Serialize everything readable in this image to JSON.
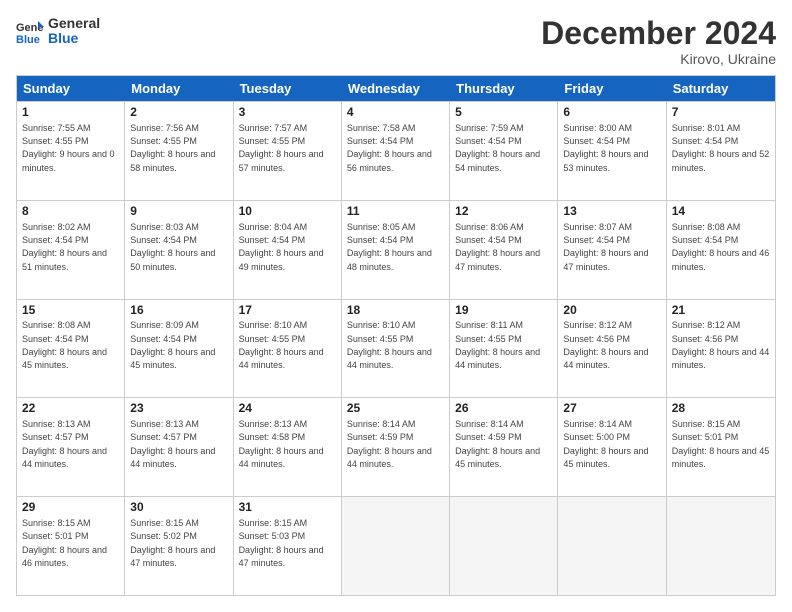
{
  "logo": {
    "line1": "General",
    "line2": "Blue"
  },
  "title": "December 2024",
  "location": "Kirovo, Ukraine",
  "header": {
    "days": [
      "Sunday",
      "Monday",
      "Tuesday",
      "Wednesday",
      "Thursday",
      "Friday",
      "Saturday"
    ]
  },
  "weeks": [
    [
      {
        "day": "1",
        "sunrise": "7:55 AM",
        "sunset": "4:55 PM",
        "daylight": "9 hours and 0 minutes."
      },
      {
        "day": "2",
        "sunrise": "7:56 AM",
        "sunset": "4:55 PM",
        "daylight": "8 hours and 58 minutes."
      },
      {
        "day": "3",
        "sunrise": "7:57 AM",
        "sunset": "4:55 PM",
        "daylight": "8 hours and 57 minutes."
      },
      {
        "day": "4",
        "sunrise": "7:58 AM",
        "sunset": "4:54 PM",
        "daylight": "8 hours and 56 minutes."
      },
      {
        "day": "5",
        "sunrise": "7:59 AM",
        "sunset": "4:54 PM",
        "daylight": "8 hours and 54 minutes."
      },
      {
        "day": "6",
        "sunrise": "8:00 AM",
        "sunset": "4:54 PM",
        "daylight": "8 hours and 53 minutes."
      },
      {
        "day": "7",
        "sunrise": "8:01 AM",
        "sunset": "4:54 PM",
        "daylight": "8 hours and 52 minutes."
      }
    ],
    [
      {
        "day": "8",
        "sunrise": "8:02 AM",
        "sunset": "4:54 PM",
        "daylight": "8 hours and 51 minutes."
      },
      {
        "day": "9",
        "sunrise": "8:03 AM",
        "sunset": "4:54 PM",
        "daylight": "8 hours and 50 minutes."
      },
      {
        "day": "10",
        "sunrise": "8:04 AM",
        "sunset": "4:54 PM",
        "daylight": "8 hours and 49 minutes."
      },
      {
        "day": "11",
        "sunrise": "8:05 AM",
        "sunset": "4:54 PM",
        "daylight": "8 hours and 48 minutes."
      },
      {
        "day": "12",
        "sunrise": "8:06 AM",
        "sunset": "4:54 PM",
        "daylight": "8 hours and 47 minutes."
      },
      {
        "day": "13",
        "sunrise": "8:07 AM",
        "sunset": "4:54 PM",
        "daylight": "8 hours and 47 minutes."
      },
      {
        "day": "14",
        "sunrise": "8:08 AM",
        "sunset": "4:54 PM",
        "daylight": "8 hours and 46 minutes."
      }
    ],
    [
      {
        "day": "15",
        "sunrise": "8:08 AM",
        "sunset": "4:54 PM",
        "daylight": "8 hours and 45 minutes."
      },
      {
        "day": "16",
        "sunrise": "8:09 AM",
        "sunset": "4:54 PM",
        "daylight": "8 hours and 45 minutes."
      },
      {
        "day": "17",
        "sunrise": "8:10 AM",
        "sunset": "4:55 PM",
        "daylight": "8 hours and 44 minutes."
      },
      {
        "day": "18",
        "sunrise": "8:10 AM",
        "sunset": "4:55 PM",
        "daylight": "8 hours and 44 minutes."
      },
      {
        "day": "19",
        "sunrise": "8:11 AM",
        "sunset": "4:55 PM",
        "daylight": "8 hours and 44 minutes."
      },
      {
        "day": "20",
        "sunrise": "8:12 AM",
        "sunset": "4:56 PM",
        "daylight": "8 hours and 44 minutes."
      },
      {
        "day": "21",
        "sunrise": "8:12 AM",
        "sunset": "4:56 PM",
        "daylight": "8 hours and 44 minutes."
      }
    ],
    [
      {
        "day": "22",
        "sunrise": "8:13 AM",
        "sunset": "4:57 PM",
        "daylight": "8 hours and 44 minutes."
      },
      {
        "day": "23",
        "sunrise": "8:13 AM",
        "sunset": "4:57 PM",
        "daylight": "8 hours and 44 minutes."
      },
      {
        "day": "24",
        "sunrise": "8:13 AM",
        "sunset": "4:58 PM",
        "daylight": "8 hours and 44 minutes."
      },
      {
        "day": "25",
        "sunrise": "8:14 AM",
        "sunset": "4:59 PM",
        "daylight": "8 hours and 44 minutes."
      },
      {
        "day": "26",
        "sunrise": "8:14 AM",
        "sunset": "4:59 PM",
        "daylight": "8 hours and 45 minutes."
      },
      {
        "day": "27",
        "sunrise": "8:14 AM",
        "sunset": "5:00 PM",
        "daylight": "8 hours and 45 minutes."
      },
      {
        "day": "28",
        "sunrise": "8:15 AM",
        "sunset": "5:01 PM",
        "daylight": "8 hours and 45 minutes."
      }
    ],
    [
      {
        "day": "29",
        "sunrise": "8:15 AM",
        "sunset": "5:01 PM",
        "daylight": "8 hours and 46 minutes."
      },
      {
        "day": "30",
        "sunrise": "8:15 AM",
        "sunset": "5:02 PM",
        "daylight": "8 hours and 47 minutes."
      },
      {
        "day": "31",
        "sunrise": "8:15 AM",
        "sunset": "5:03 PM",
        "daylight": "8 hours and 47 minutes."
      },
      null,
      null,
      null,
      null
    ]
  ]
}
